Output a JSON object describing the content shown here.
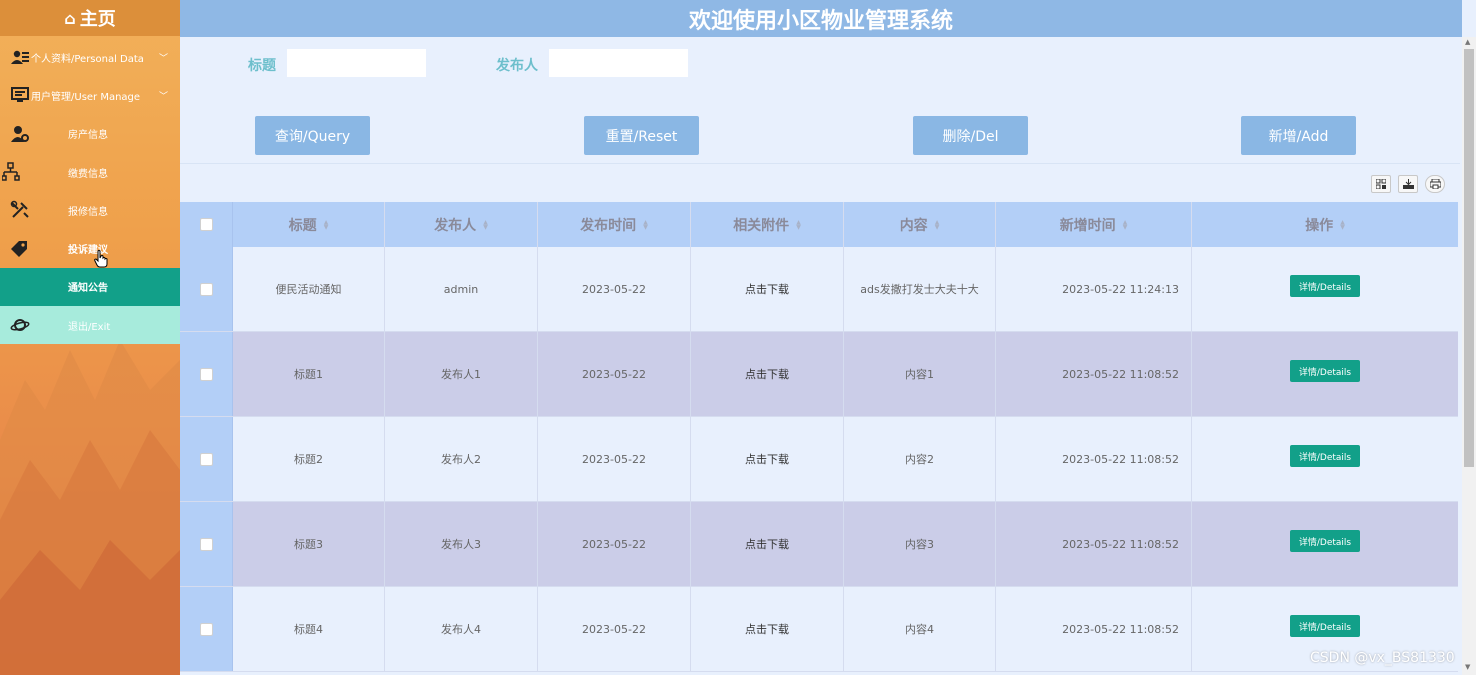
{
  "header": {
    "title": "欢迎使用小区物业管理系统"
  },
  "sidebar": {
    "home_label": "主页",
    "items": [
      {
        "label": "个人资料/Personal Data",
        "icon": "user-card-icon",
        "has_chevron": true
      },
      {
        "label": "用户管理/User Manage",
        "icon": "monitor-icon",
        "has_chevron": true
      },
      {
        "label": "房产信息",
        "icon": "user-gear-icon"
      },
      {
        "label": "缴费信息",
        "icon": "sitemap-icon"
      },
      {
        "label": "报修信息",
        "icon": "tools-icon"
      },
      {
        "label": "投诉建议",
        "icon": "tags-icon"
      },
      {
        "label": "通知公告",
        "icon": "",
        "active": true
      },
      {
        "label": "退出/Exit",
        "icon": "planet-icon"
      }
    ]
  },
  "search": {
    "title_label": "标题",
    "publisher_label": "发布人",
    "title_value": "",
    "publisher_value": ""
  },
  "buttons": {
    "query": "查询/Query",
    "reset": "重置/Reset",
    "delete": "删除/Del",
    "add": "新增/Add"
  },
  "table": {
    "columns": [
      "标题",
      "发布人",
      "发布时间",
      "相关附件",
      "内容",
      "新增时间",
      "操作"
    ],
    "rows": [
      {
        "title": "便民活动通知",
        "publisher": "admin",
        "publish_date": "2023-05-22",
        "attachment": "点击下载",
        "content": "ads发撒打发士大夫十大",
        "created": "2023-05-22 11:24:13",
        "action": "详情/Details"
      },
      {
        "title": "标题1",
        "publisher": "发布人1",
        "publish_date": "2023-05-22",
        "attachment": "点击下载",
        "content": "内容1",
        "created": "2023-05-22 11:08:52",
        "action": "详情/Details"
      },
      {
        "title": "标题2",
        "publisher": "发布人2",
        "publish_date": "2023-05-22",
        "attachment": "点击下载",
        "content": "内容2",
        "created": "2023-05-22 11:08:52",
        "action": "详情/Details"
      },
      {
        "title": "标题3",
        "publisher": "发布人3",
        "publish_date": "2023-05-22",
        "attachment": "点击下载",
        "content": "内容3",
        "created": "2023-05-22 11:08:52",
        "action": "详情/Details"
      },
      {
        "title": "标题4",
        "publisher": "发布人4",
        "publish_date": "2023-05-22",
        "attachment": "点击下载",
        "content": "内容4",
        "created": "2023-05-22 11:08:52",
        "action": "详情/Details"
      }
    ]
  },
  "watermark": "CSDN @vx_BS81330",
  "colors": {
    "header_bg": "#8fb8e5",
    "button_bg": "#8ab7e4",
    "accent_teal": "#12a089",
    "exit_bg": "#a7ebdc",
    "sidebar_orange": "#efa04b",
    "row_alt": "#cbcde8",
    "table_header": "#b3cff7"
  }
}
